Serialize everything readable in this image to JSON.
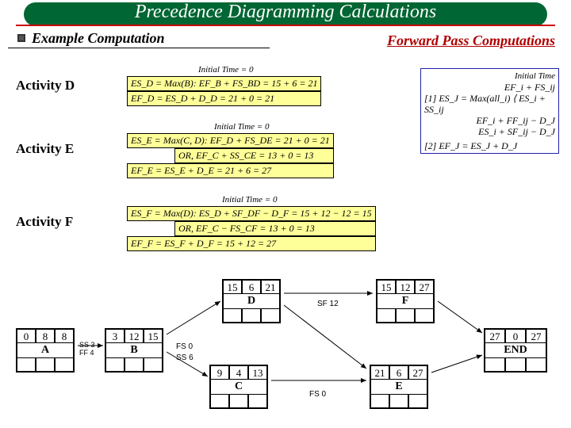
{
  "title": "Precedence Diagramming Calculations",
  "subtitle": "Example Computation",
  "forward_pass": "Forward Pass Computations",
  "labels": {
    "actD": "Activity D",
    "actE": "Activity E",
    "actF": "Activity F"
  },
  "formulas": {
    "D": {
      "initial": "Initial Time = 0",
      "line1": "ES_D = Max(B): EF_B + FS_BD = 15 + 6 = 21",
      "line2": "EF_D = ES_D + D_D = 21 + 0 = 21"
    },
    "E": {
      "initial": "Initial Time = 0",
      "line1": "ES_E = Max(C, D): EF_D + FS_DE = 21 + 0 = 21",
      "line2": "OR, EF_C + SS_CE = 13 + 0 = 13",
      "line3": "EF_E = ES_E + D_E = 21 + 6 = 27"
    },
    "F": {
      "initial": "Initial Time = 0",
      "line1": "ES_F = Max(D): ES_D + SF_DF − D_F = 15 + 12 − 12 = 15",
      "line2": "OR, EF_C − FS_CF = 13 + 0 = 13",
      "line3": "EF_F = ES_F + D_F = 15 + 12 = 27"
    },
    "side": {
      "top_label": "Initial Time",
      "l1": "EF_i + FS_ij",
      "l2": "[1] ES_J = Max(all_i) ⟨ ES_i + SS_ij",
      "l3": "EF_i + FF_ij − D_J",
      "l4": "ES_i + SF_ij − D_J",
      "l5": "[2] EF_J = ES_J + D_J"
    }
  },
  "nodes": {
    "A": {
      "name": "A",
      "es": "0",
      "d": "8",
      "ef": "8"
    },
    "B": {
      "name": "B",
      "es": "3",
      "d": "12",
      "ef": "15"
    },
    "C": {
      "name": "C",
      "es": "9",
      "d": "4",
      "ef": "13"
    },
    "D": {
      "name": "D",
      "es": "15",
      "d": "6",
      "ef": "21"
    },
    "E": {
      "name": "E",
      "es": "21",
      "d": "6",
      "ef": "27"
    },
    "F": {
      "name": "F",
      "es": "15",
      "d": "12",
      "ef": "27"
    },
    "END": {
      "name": "END",
      "es": "27",
      "d": "0",
      "ef": "27"
    }
  },
  "edges": {
    "ab_ss": "SS 3",
    "ab_ff": "FF 4",
    "bc_fs": "FS 0",
    "bc_ss": "SS 6",
    "bd": "",
    "df_sf": "SF 12",
    "ce_fs": "FS 0",
    "de": "",
    "e_end": "",
    "f_end": ""
  },
  "chart_data": {
    "type": "table",
    "title": "Precedence Diagramming — Forward Pass",
    "activities": [
      {
        "id": "A",
        "ES": 0,
        "D": 8,
        "EF": 8
      },
      {
        "id": "B",
        "ES": 3,
        "D": 12,
        "EF": 15
      },
      {
        "id": "C",
        "ES": 9,
        "D": 4,
        "EF": 13
      },
      {
        "id": "D",
        "ES": 15,
        "D": 6,
        "EF": 21
      },
      {
        "id": "E",
        "ES": 21,
        "D": 6,
        "EF": 27
      },
      {
        "id": "F",
        "ES": 15,
        "D": 12,
        "EF": 27
      },
      {
        "id": "END",
        "ES": 27,
        "D": 0,
        "EF": 27
      }
    ],
    "relationships": [
      {
        "from": "A",
        "to": "B",
        "type": "SS",
        "lag": 3
      },
      {
        "from": "A",
        "to": "B",
        "type": "FF",
        "lag": 4
      },
      {
        "from": "B",
        "to": "C",
        "type": "FS",
        "lag": 0
      },
      {
        "from": "B",
        "to": "C",
        "type": "SS",
        "lag": 6
      },
      {
        "from": "B",
        "to": "D",
        "type": "FS",
        "lag": 0
      },
      {
        "from": "D",
        "to": "F",
        "type": "SF",
        "lag": 12
      },
      {
        "from": "C",
        "to": "E",
        "type": "FS",
        "lag": 0
      },
      {
        "from": "D",
        "to": "E",
        "type": "FS",
        "lag": 0
      },
      {
        "from": "E",
        "to": "END",
        "type": "FS",
        "lag": 0
      },
      {
        "from": "F",
        "to": "END",
        "type": "FS",
        "lag": 0
      }
    ]
  }
}
